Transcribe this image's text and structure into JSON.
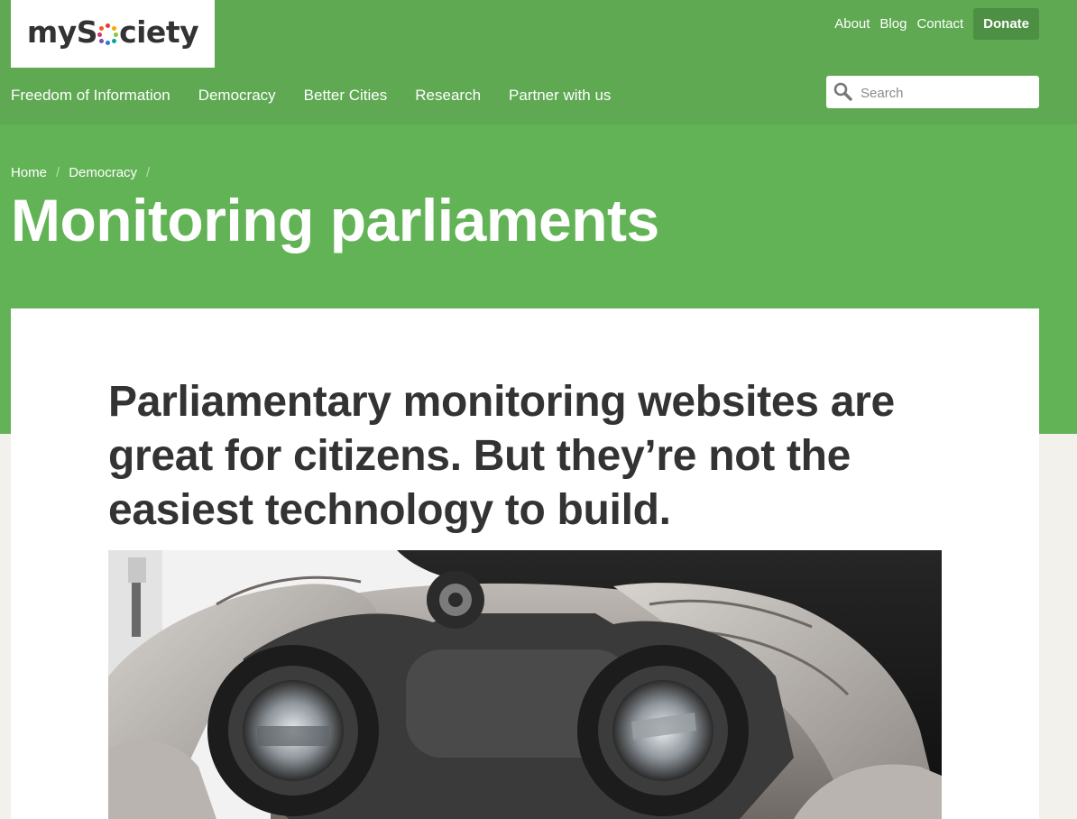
{
  "logo": {
    "prefix": "myS",
    "suffix": "ciety"
  },
  "topnav": {
    "about": "About",
    "blog": "Blog",
    "contact": "Contact",
    "donate": "Donate"
  },
  "mainnav": {
    "items": [
      "Freedom of Information",
      "Democracy",
      "Better Cities",
      "Research",
      "Partner with us"
    ]
  },
  "search": {
    "placeholder": "Search",
    "icon": "search-icon"
  },
  "breadcrumb": {
    "home": "Home",
    "democracy": "Democracy"
  },
  "page_title": "Monitoring parliaments",
  "lead": "Parliamentary monitoring websites are great for citizens. But they’re not the easiest technology to build.",
  "hero_image": {
    "subject": "binoculars-photo"
  },
  "colors": {
    "brand_green": "#62b356",
    "header_green": "#5ea952",
    "donate_green": "#4d8f43",
    "text_dark": "#333333"
  }
}
